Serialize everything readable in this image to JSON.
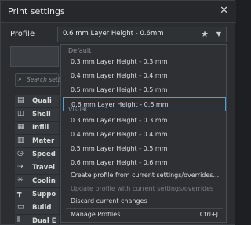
{
  "window": {
    "title": "Print settings"
  },
  "profile": {
    "label": "Profile",
    "selected": "0.6 mm Layer Height - 0.6mm"
  },
  "search": {
    "placeholder": "Search settin"
  },
  "categories": [
    {
      "icon": "quality-icon",
      "label": "Quali"
    },
    {
      "icon": "shell-icon",
      "label": "Shell"
    },
    {
      "icon": "infill-icon",
      "label": "Infill"
    },
    {
      "icon": "material-icon",
      "label": "Mater"
    },
    {
      "icon": "speed-icon",
      "label": "Speed"
    },
    {
      "icon": "travel-icon",
      "label": "Travel"
    },
    {
      "icon": "cooling-icon",
      "label": "Coolin"
    },
    {
      "icon": "support-icon",
      "label": "Suppo"
    },
    {
      "icon": "build-plate-icon",
      "label": "Build"
    },
    {
      "icon": "dual-extrusion-icon",
      "label": "Dual E"
    }
  ],
  "dropdown": {
    "section_default": "Default",
    "section_visual": "Visual",
    "default_items": [
      "0.3 mm Layer Height - 0.3 mm",
      "0.4 mm Layer Height - 0.4 mm",
      "0.5 mm Layer Height - 0.5 mm",
      "0.6 mm Layer Height - 0.6 mm"
    ],
    "visual_items": [
      "0.3 mm Layer Height - 0.3 mm",
      "0.4 mm Layer Height - 0.4 mm",
      "0.5 mm Layer Height - 0.5 mm",
      "0.6 mm Layer Height - 0.6 mm"
    ],
    "actions": {
      "create": "Create profile from current settings/overrides...",
      "update": "Update profile with current settings/overrides",
      "discard": "Discard current changes",
      "manage": "Manage Profiles...",
      "manage_shortcut": "Ctrl+J"
    }
  }
}
